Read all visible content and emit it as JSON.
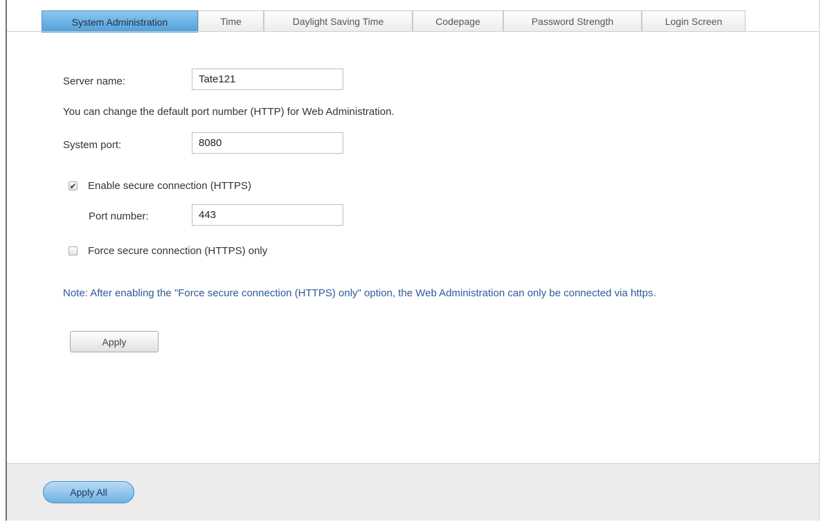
{
  "tabs": [
    {
      "label": "System Administration",
      "active": true
    },
    {
      "label": "Time",
      "active": false
    },
    {
      "label": "Daylight Saving Time",
      "active": false
    },
    {
      "label": "Codepage",
      "active": false
    },
    {
      "label": "Password Strength",
      "active": false
    },
    {
      "label": "Login Screen",
      "active": false
    }
  ],
  "form": {
    "server_name_label": "Server name:",
    "server_name_value": "Tate121",
    "port_description": "You can change the default port number (HTTP) for Web Administration.",
    "system_port_label": "System port:",
    "system_port_value": "8080",
    "https_label": "Enable secure connection (HTTPS)",
    "https_checked": true,
    "port_number_label": "Port number:",
    "port_number_value": "443",
    "force_https_label": "Force secure connection (HTTPS) only",
    "force_https_checked": false,
    "note": "Note: After enabling the \"Force secure connection (HTTPS) only\" option, the Web Administration can only be connected via https.",
    "apply_label": "Apply",
    "check_glyph": "✔"
  },
  "footer": {
    "apply_all_label": "Apply All"
  },
  "colors": {
    "active_tab": "#5aa6de",
    "note_text": "#2d5a96",
    "footer_bg": "#ececec"
  }
}
